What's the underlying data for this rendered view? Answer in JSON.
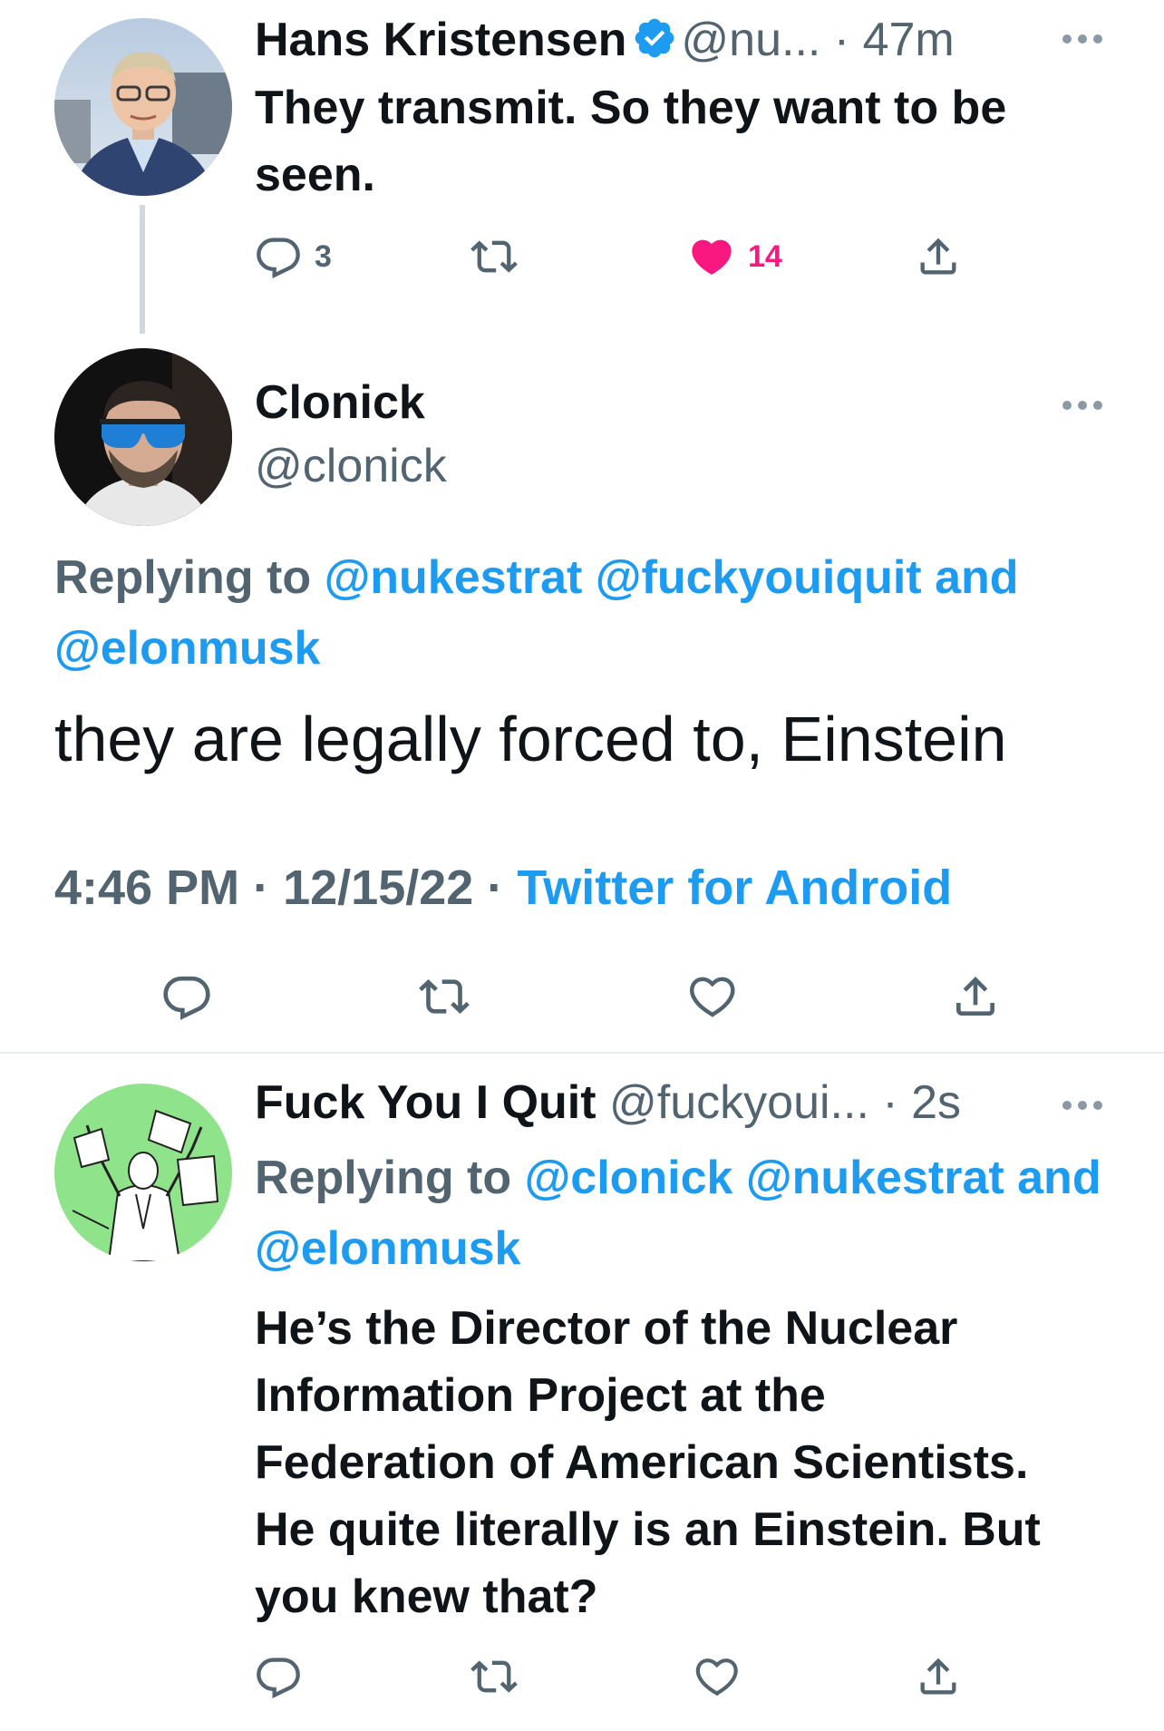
{
  "tweet1": {
    "name": "Hans Kristensen",
    "handle": "@nu...",
    "dot": " · ",
    "time": "47m",
    "text": "They transmit. So they want to be seen.",
    "reply_count": "3",
    "retweet_count": "",
    "like_count": "14",
    "liked": true
  },
  "main_tweet": {
    "name": "Clonick",
    "handle": "@clonick",
    "replying_label": "Replying to",
    "reply_mentions": [
      "@nukestrat",
      "@fuckyouiquit",
      "and",
      "@elonmusk"
    ],
    "text": "they are legally forced to, Einstein",
    "time": "4:46 PM",
    "date": "12/15/22",
    "sep": " · ",
    "source": "Twitter for Android"
  },
  "tweet3": {
    "name": "Fuck You I Quit",
    "handle": "@fuckyoui...",
    "dot": " · ",
    "time": "2s",
    "replying_label": "Replying to",
    "reply_mentions": [
      "@clonick",
      "@nukestrat",
      "and",
      "@elonmusk"
    ],
    "text_lines": [
      "He’s the Director of the Nuclear",
      "Information Project at the",
      "Federation of American Scientists.",
      "He quite literally is an Einstein. But",
      "you knew that?"
    ]
  },
  "icons": {
    "reply": "reply-icon",
    "retweet": "retweet-icon",
    "like": "heart-icon",
    "share": "share-icon",
    "more": "more-icon",
    "verified": "verified-badge-icon"
  },
  "colors": {
    "link": "#1d9bf0",
    "secondary_text": "#536471",
    "like": "#f91880",
    "verified": "#1d9bf0"
  }
}
